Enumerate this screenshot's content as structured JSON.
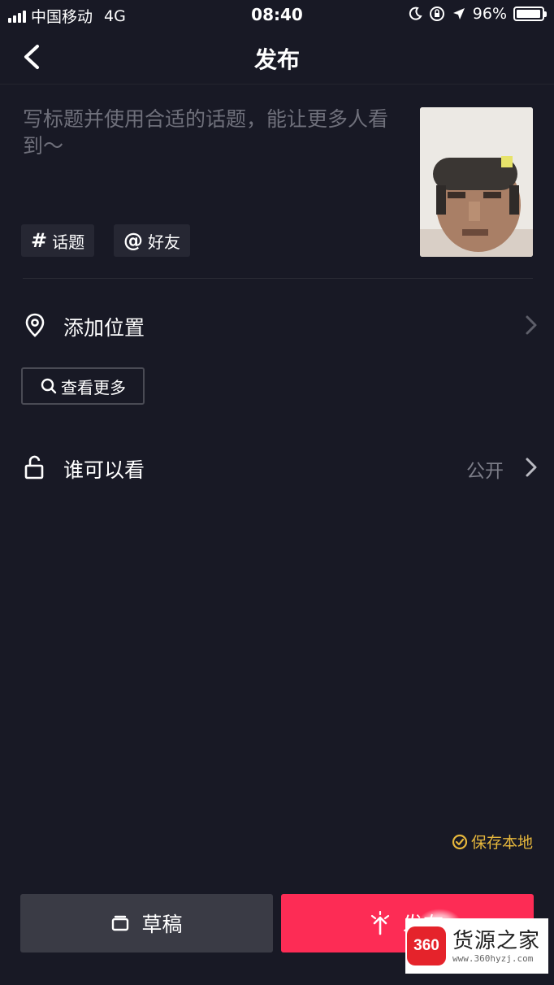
{
  "status_bar": {
    "carrier": "中国移动",
    "network": "4G",
    "time": "08:40",
    "battery": "96%",
    "battery_level": 0.96
  },
  "nav": {
    "title": "发布",
    "back_icon": "chevron-left-icon"
  },
  "post": {
    "caption_placeholder": "写标题并使用合适的话题，能让更多人看到～",
    "tags": [
      {
        "symbol": "#",
        "label": "话题"
      },
      {
        "symbol": "@",
        "label": "好友"
      }
    ]
  },
  "location": {
    "label": "添加位置",
    "icon": "location-pin-icon",
    "more_button": "查看更多"
  },
  "visibility": {
    "label": "谁可以看",
    "value": "公开",
    "icon": "unlock-icon"
  },
  "save_local": {
    "label": "保存本地",
    "checked": true,
    "color": "#e6b73c"
  },
  "actions": {
    "draft_label": "草稿",
    "publish_label": "发布",
    "publish_color": "#fd2c55"
  },
  "watermark": {
    "logo_text": "360",
    "name": "货源之家",
    "url": "www.360hyzj.com"
  }
}
